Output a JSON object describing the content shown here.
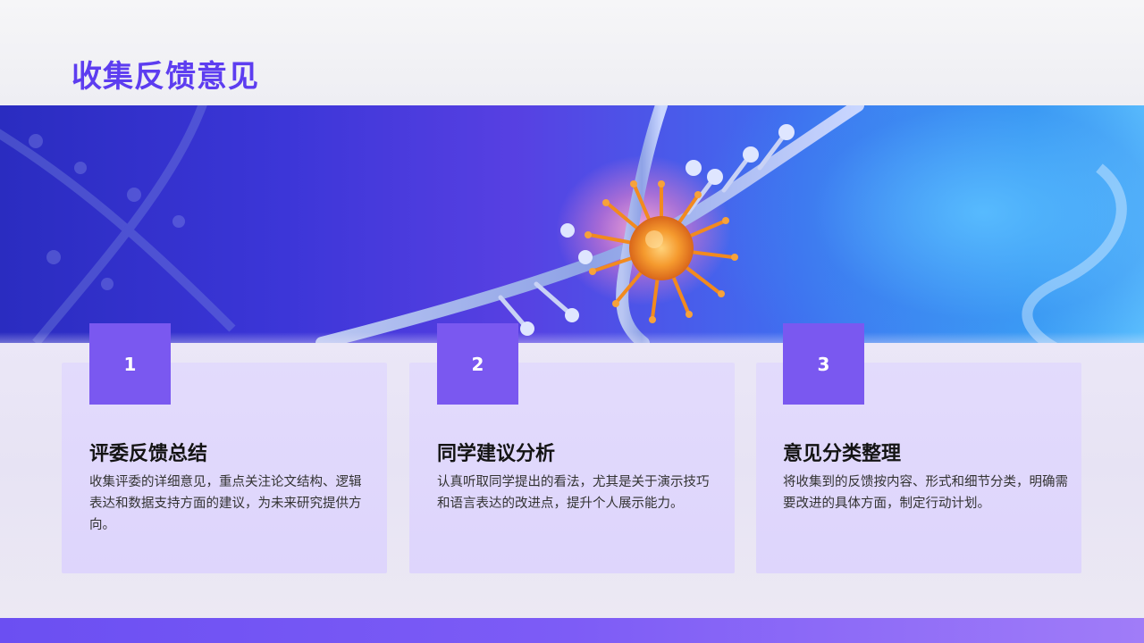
{
  "slide": {
    "title": "收集反馈意见",
    "accent_color": "#7a58f0",
    "title_color": "#5d3df0",
    "banner_image": "dna-helix-virus-illustration"
  },
  "cards": [
    {
      "number": "1",
      "heading": "评委反馈总结",
      "description": "收集评委的详细意见，重点关注论文结构、逻辑表达和数据支持方面的建议，为未来研究提供方向。"
    },
    {
      "number": "2",
      "heading": "同学建议分析",
      "description": "认真听取同学提出的看法，尤其是关于演示技巧和语言表达的改进点，提升个人展示能力。"
    },
    {
      "number": "3",
      "heading": "意见分类整理",
      "description": "将收集到的反馈按内容、形式和细节分类，明确需要改进的具体方面，制定行动计划。"
    }
  ]
}
